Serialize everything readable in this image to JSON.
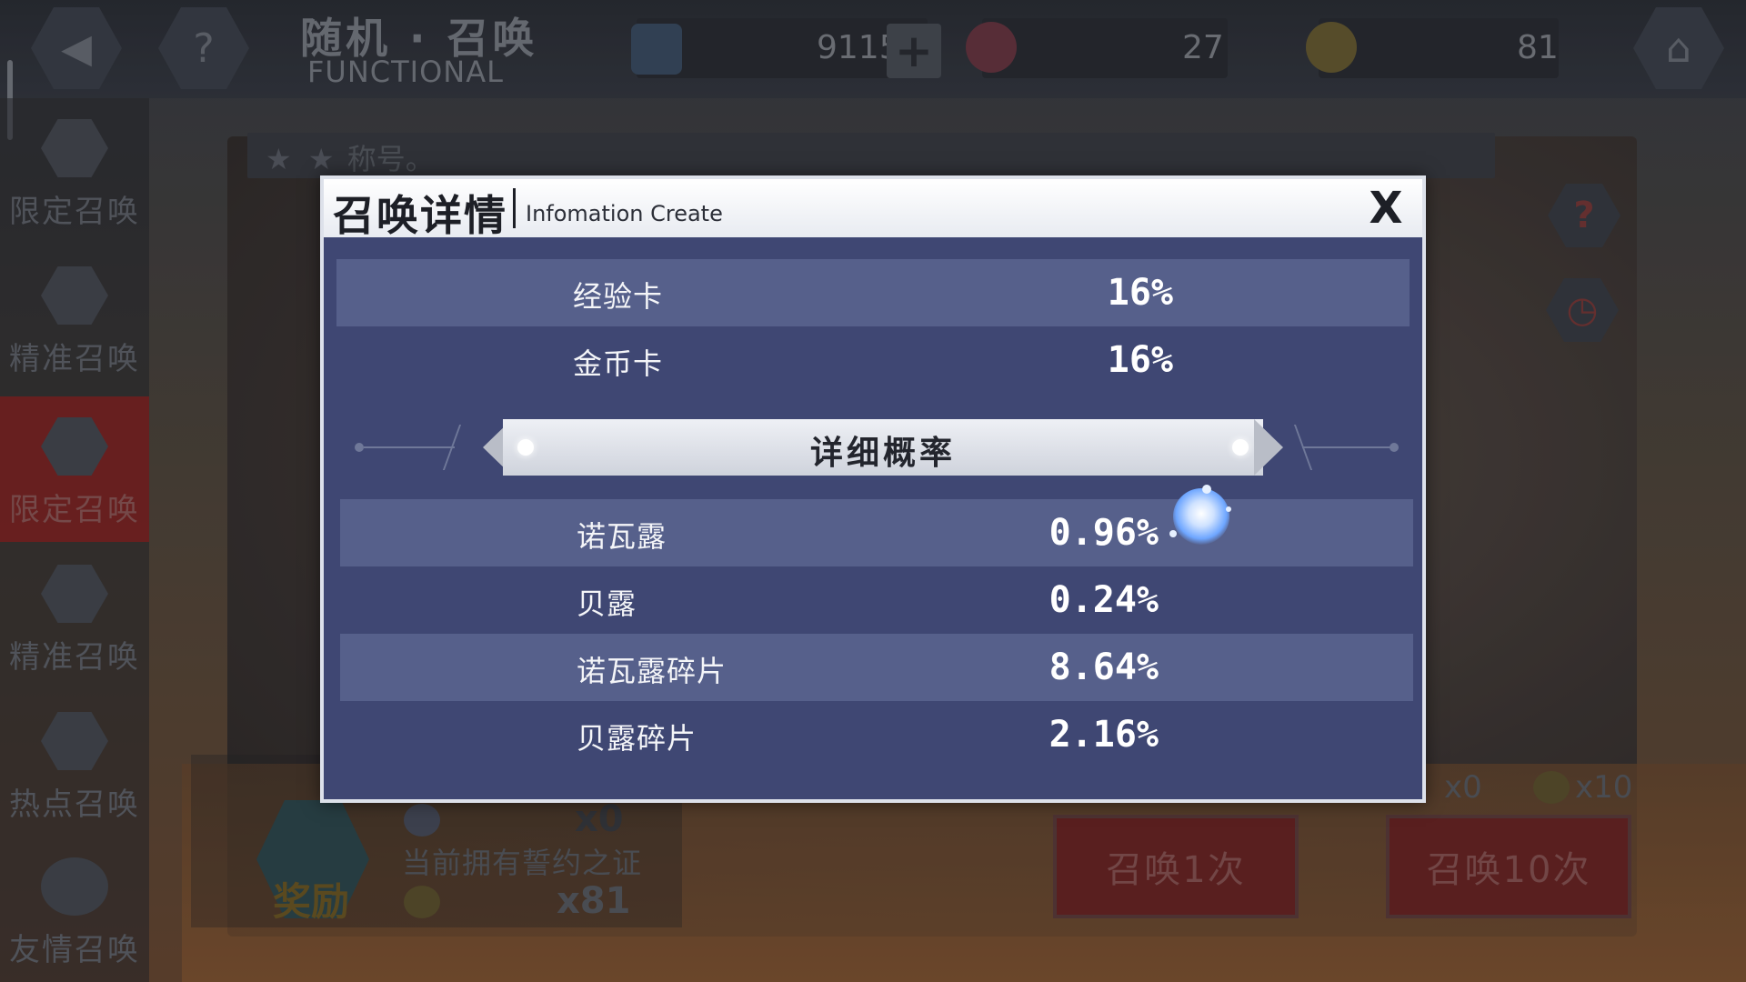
{
  "header": {
    "title": "随机 · 召唤",
    "subtitle": "FUNCTIONAL",
    "resources": [
      {
        "name": "cube",
        "value": "9115",
        "icon": "cube-icon"
      },
      {
        "name": "heart-crest",
        "value": "27",
        "icon": "heart-crest-icon"
      },
      {
        "name": "gold-crest",
        "value": "81",
        "icon": "gold-crest-icon"
      }
    ]
  },
  "sidebar": {
    "items": [
      {
        "label": "限定召唤",
        "icon": "hexagons-icon",
        "active": false
      },
      {
        "label": "精准召唤",
        "icon": "eye-emblem-icon",
        "active": false
      },
      {
        "label": "限定召唤",
        "icon": "hexagons-icon",
        "active": true
      },
      {
        "label": "精准召唤",
        "icon": "eye-emblem-icon",
        "active": false
      },
      {
        "label": "热点召唤",
        "icon": "sword-emblem-icon",
        "active": false
      },
      {
        "label": "友情召唤",
        "icon": "heart-icon",
        "active": false
      }
    ]
  },
  "name_strip": {
    "stars": "★ ★",
    "text": "称号。"
  },
  "bottom": {
    "reward_label": "奖励",
    "pledge_text": "当前拥有誓约之证",
    "pledge_count_a": "x0",
    "pledge_count_b": "x81",
    "cost_single": "x0",
    "cost_ten": "x10",
    "summon_once": "召唤1次",
    "summon_ten": "召唤10次"
  },
  "modal": {
    "title": "召唤详情",
    "subtitle": "Infomation Create",
    "close": "X",
    "top_rows": [
      {
        "name": "经验卡",
        "rate": "16%"
      },
      {
        "name": "金币卡",
        "rate": "16%"
      }
    ],
    "section_title": "详细概率",
    "detail_rows": [
      {
        "name": "诺瓦露",
        "rate": "0.96%"
      },
      {
        "name": "贝露",
        "rate": "0.24%"
      },
      {
        "name": "诺瓦露碎片",
        "rate": "8.64%"
      },
      {
        "name": "贝露碎片",
        "rate": "2.16%"
      }
    ]
  },
  "colors": {
    "modal_bg": "#3f4773",
    "row_stripe": "#56608b",
    "header_bg": "#ffffff",
    "active_tab": "#962323"
  }
}
